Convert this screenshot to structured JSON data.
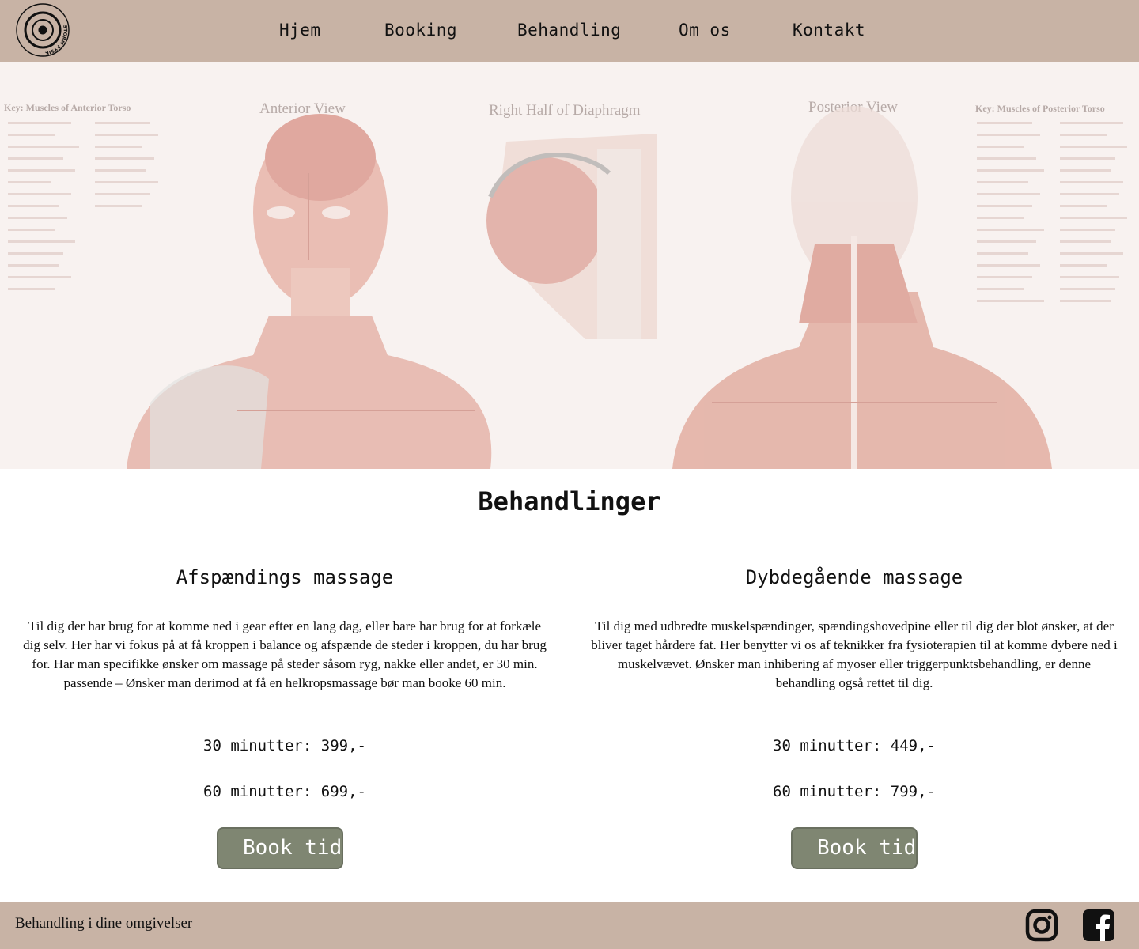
{
  "header": {
    "logo_text": "STORM FYSIK",
    "nav": [
      {
        "label": "Hjem"
      },
      {
        "label": "Booking"
      },
      {
        "label": "Behandling"
      },
      {
        "label": "Om os"
      },
      {
        "label": "Kontakt"
      }
    ]
  },
  "hero": {
    "image_labels": {
      "key_anterior": "Key: Muscles of Anterior Torso",
      "anterior_view": "Anterior View",
      "diaphragm": "Right Half of Diaphragm",
      "posterior_view": "Posterior View",
      "key_posterior": "Key: Muscles of Posterior Torso"
    }
  },
  "main": {
    "title": "Behandlinger",
    "treatments": [
      {
        "heading": "Afspændings massage",
        "description": "Til dig der har brug for at komme ned i gear efter en lang dag, eller bare har brug for at forkæle dig selv. Her har vi fokus på at få kroppen i balance og afspænde de steder i kroppen, du har brug for. Har man specifikke ønsker om massage på steder såsom ryg, nakke eller andet, er 30 min. passende – Ønsker man derimod at få en helkropsmassage bør man booke 60 min.",
        "price_30": "30 minutter: 399,-",
        "price_60": "60 minutter: 699,-",
        "button": "Book tid"
      },
      {
        "heading": "Dybdegående massage",
        "description": "Til dig med udbredte muskelspændinger, spændingshovedpine eller til dig der blot ønsker, at der bliver taget hårdere fat. Her benytter vi os af teknikker fra fysioterapien til at komme dybere ned i muskelvævet. Ønsker man inhibering af myoser eller triggerpunktsbehandling, er denne behandling også rettet til dig.",
        "price_30": "30 minutter: 449,-",
        "price_60": "60 minutter: 799,-",
        "button": "Book tid"
      }
    ]
  },
  "footer": {
    "text": "Behandling i dine omgivelser",
    "social": [
      {
        "icon": "instagram-icon"
      },
      {
        "icon": "facebook-icon"
      }
    ]
  },
  "colors": {
    "header_bg": "#c8b3a5",
    "button_bg": "#7f8672",
    "hero_bg": "#f6eeeb"
  }
}
